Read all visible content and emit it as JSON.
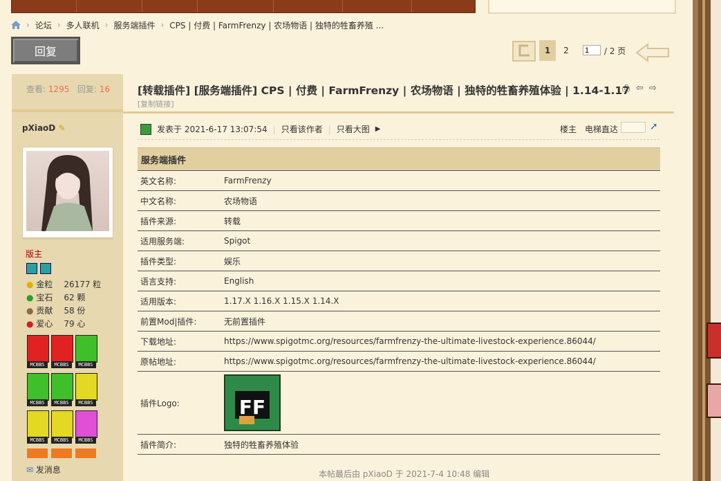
{
  "breadcrumb": {
    "items": [
      "论坛",
      "多人联机",
      "服务端插件",
      "CPS | 付费 | FarmFrenzy | 农场物语 | 独特的牲畜养殖 ..."
    ]
  },
  "reply_button": {
    "label": "回复"
  },
  "pager": {
    "current": "1",
    "next": "2",
    "input_value": "1",
    "total": "/ 2 页"
  },
  "thread": {
    "views_label": "查看:",
    "views": "1295",
    "replies_label": "回复:",
    "replies": "16",
    "title": "[转载插件] [服务端插件] CPS | 付费 | FarmFrenzy | 农场物语 | 独特的牲畜养殖体验 | 1.14-1.17",
    "copy_link": "[复制链接]"
  },
  "author": {
    "name": "pXiaoD",
    "role": "版主",
    "attributes": [
      {
        "label": "金粒",
        "value": "26177 粒"
      },
      {
        "label": "宝石",
        "value": "62 颗"
      },
      {
        "label": "贡献",
        "value": "58 份"
      },
      {
        "label": "爱心",
        "value": "79 心"
      }
    ],
    "badges": [
      {
        "icon": "redstone-block-badge",
        "color": "#e12222",
        "label": "MCBBS"
      },
      {
        "icon": "java-badge",
        "color": "#e12222",
        "label": "MCBBS"
      },
      {
        "icon": "cake-badge",
        "color": "#3fbf2a",
        "label": "MCBBS"
      },
      {
        "icon": "news-badge",
        "color": "#3fbf2a",
        "label": "MCBBS"
      },
      {
        "icon": "anvil-badge",
        "color": "#3fbf2a",
        "label": "MCBBS"
      },
      {
        "icon": "pickaxe-badge",
        "color": "#e3d822",
        "label": "MCBBS"
      },
      {
        "icon": "pickaxe-badge",
        "color": "#e3d822",
        "label": "MCBBS"
      },
      {
        "icon": "diamond-pickaxe-badge",
        "color": "#e3d822",
        "label": "MCBBS"
      },
      {
        "icon": "potion-badge",
        "color": "#e04fd6",
        "label": "MCBBS"
      }
    ],
    "send_message": "发消息"
  },
  "post": {
    "posted_at": "发表于 2021-6-17 13:07:54",
    "only_author": "只看该作者",
    "only_images": "只看大图",
    "floor": "楼主",
    "jump_label": "电梯直达",
    "edit_note": "本帖最后由 pXiaoD 于 2021-7-4 10:48 编辑"
  },
  "plugin_table": {
    "header": "服务端插件",
    "rows": [
      {
        "key": "英文名称:",
        "value": "FarmFrenzy"
      },
      {
        "key": "中文名称:",
        "value": "农场物语"
      },
      {
        "key": "插件来源:",
        "value": "转载"
      },
      {
        "key": "适用服务端:",
        "value": "Spigot"
      },
      {
        "key": "插件类型:",
        "value": "娱乐"
      },
      {
        "key": "语言支持:",
        "value": "English"
      },
      {
        "key": "适用版本:",
        "value": "1.17.X 1.16.X 1.15.X 1.14.X"
      },
      {
        "key": "前置Mod|插件:",
        "value": "无前置插件"
      },
      {
        "key": "下载地址:",
        "value": "https://www.spigotmc.org/resources/farmfrenzy-the-ultimate-livestock-experience.86044/"
      },
      {
        "key": "原帖地址:",
        "value": "https://www.spigotmc.org/resources/farmfrenzy-the-ultimate-livestock-experience.86044/"
      },
      {
        "key": "插件Logo:",
        "value": "FF"
      },
      {
        "key": "插件简介:",
        "value": "独特的牲畜养殖体验"
      }
    ]
  },
  "colors": {
    "page_bg": "#fbf2db",
    "sidebar_bg": "#e7d8b0",
    "table_header_bg": "#e2cfa0",
    "accent_orange": "#f26c4f",
    "moderator_red": "#aa0000",
    "nav_brown": "#8b3a1a"
  }
}
